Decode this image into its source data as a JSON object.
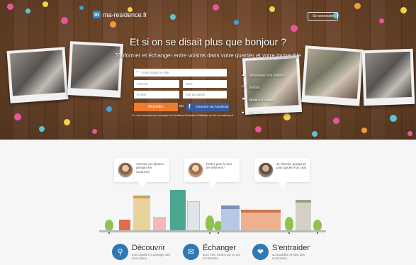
{
  "header": {
    "logo": "ma-residence.fr",
    "connect": "Se connecter"
  },
  "hero": {
    "title": "Et si on se disait plus que bonjour ?",
    "subtitle": "S'informer et échanger entre voisins dans votre quartier et votre immeuble"
  },
  "form": {
    "address_placeholder": "Code postal ou ville",
    "firstname_placeholder": "Prénom",
    "lastname_placeholder": "Nom",
    "email_placeholder": "E-mail",
    "password_placeholder": "Mot de passe",
    "submit": "Rejoindre",
    "or": "ou",
    "facebook": "S'inscrire via Facebook",
    "terms": "En vous inscrivant vous acceptez les Conditions Générales d'Utilisation du site ma-residence.fr"
  },
  "features": [
    {
      "icon": "user-check-icon",
      "label": "Découvrez vos voisins"
    },
    {
      "icon": "thumb-up-icon",
      "label": "Gratuit"
    },
    {
      "icon": "flag-icon",
      "label": "Made in France"
    },
    {
      "icon": "lock-icon",
      "label": "Sécurisé"
    }
  ],
  "bubbles": [
    {
      "text": "J'arrose vos plantes pendant les vacances."
    },
    {
      "text": "Prêtez pour le tour de vêtement !"
    },
    {
      "text": "Je cherche quelqu'un pour garder mon chat"
    }
  ],
  "actions": [
    {
      "icon": "location-pin-icon",
      "title": "Découvrir",
      "desc": "mon quartier et partager des bons plans"
    },
    {
      "icon": "chat-icon",
      "title": "Échanger",
      "desc": "avec mes voisins sur ce qui m'intéresse"
    },
    {
      "icon": "handshake-icon",
      "title": "S'entraider",
      "desc": "au quotidien et faire des économies"
    }
  ],
  "colors": {
    "accent": "#f07b2d",
    "facebook": "#3b5998",
    "brand": "#2e79b5"
  }
}
